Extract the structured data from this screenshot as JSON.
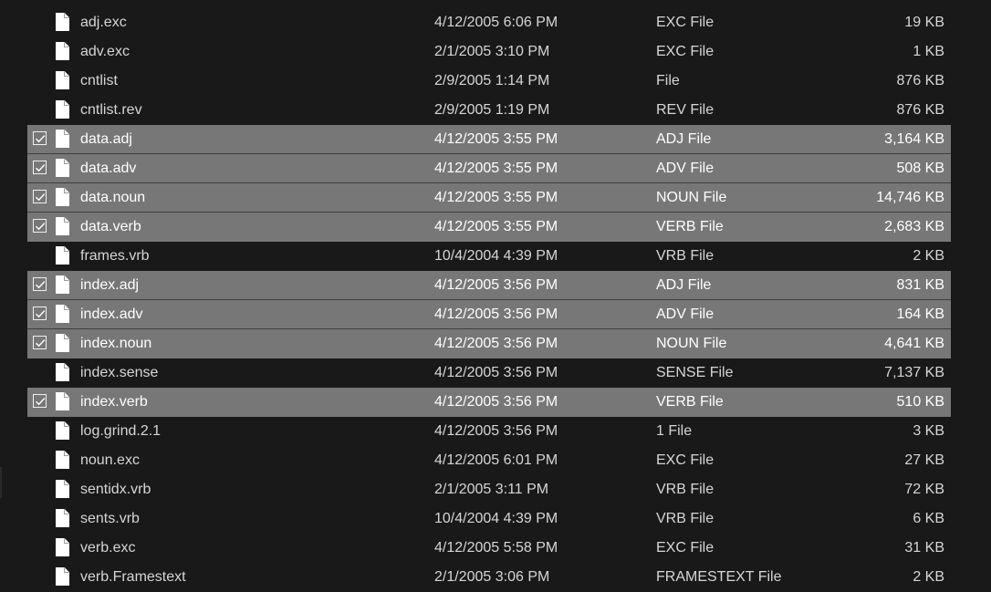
{
  "files": [
    {
      "name": "adj.exc",
      "date": "4/12/2005 6:06 PM",
      "type": "EXC File",
      "size": "19 KB",
      "selected": false
    },
    {
      "name": "adv.exc",
      "date": "2/1/2005 3:10 PM",
      "type": "EXC File",
      "size": "1 KB",
      "selected": false
    },
    {
      "name": "cntlist",
      "date": "2/9/2005 1:14 PM",
      "type": "File",
      "size": "876 KB",
      "selected": false
    },
    {
      "name": "cntlist.rev",
      "date": "2/9/2005 1:19 PM",
      "type": "REV File",
      "size": "876 KB",
      "selected": false
    },
    {
      "name": "data.adj",
      "date": "4/12/2005 3:55 PM",
      "type": "ADJ File",
      "size": "3,164 KB",
      "selected": true
    },
    {
      "name": "data.adv",
      "date": "4/12/2005 3:55 PM",
      "type": "ADV File",
      "size": "508 KB",
      "selected": true
    },
    {
      "name": "data.noun",
      "date": "4/12/2005 3:55 PM",
      "type": "NOUN File",
      "size": "14,746 KB",
      "selected": true
    },
    {
      "name": "data.verb",
      "date": "4/12/2005 3:55 PM",
      "type": "VERB File",
      "size": "2,683 KB",
      "selected": true
    },
    {
      "name": "frames.vrb",
      "date": "10/4/2004 4:39 PM",
      "type": "VRB File",
      "size": "2 KB",
      "selected": false
    },
    {
      "name": "index.adj",
      "date": "4/12/2005 3:56 PM",
      "type": "ADJ File",
      "size": "831 KB",
      "selected": true
    },
    {
      "name": "index.adv",
      "date": "4/12/2005 3:56 PM",
      "type": "ADV File",
      "size": "164 KB",
      "selected": true
    },
    {
      "name": "index.noun",
      "date": "4/12/2005 3:56 PM",
      "type": "NOUN File",
      "size": "4,641 KB",
      "selected": true
    },
    {
      "name": "index.sense",
      "date": "4/12/2005 3:56 PM",
      "type": "SENSE File",
      "size": "7,137 KB",
      "selected": false
    },
    {
      "name": "index.verb",
      "date": "4/12/2005 3:56 PM",
      "type": "VERB File",
      "size": "510 KB",
      "selected": true
    },
    {
      "name": "log.grind.2.1",
      "date": "4/12/2005 3:56 PM",
      "type": "1 File",
      "size": "3 KB",
      "selected": false
    },
    {
      "name": "noun.exc",
      "date": "4/12/2005 6:01 PM",
      "type": "EXC File",
      "size": "27 KB",
      "selected": false
    },
    {
      "name": "sentidx.vrb",
      "date": "2/1/2005 3:11 PM",
      "type": "VRB File",
      "size": "72 KB",
      "selected": false
    },
    {
      "name": "sents.vrb",
      "date": "10/4/2004 4:39 PM",
      "type": "VRB File",
      "size": "6 KB",
      "selected": false
    },
    {
      "name": "verb.exc",
      "date": "4/12/2005 5:58 PM",
      "type": "EXC File",
      "size": "31 KB",
      "selected": false
    },
    {
      "name": "verb.Framestext",
      "date": "2/1/2005 3:06 PM",
      "type": "FRAMESTEXT File",
      "size": "2 KB",
      "selected": false
    }
  ],
  "icons": {
    "file": "file-icon",
    "check": "checkmark-icon"
  },
  "colors": {
    "background": "#191919",
    "selected_row": "#777777",
    "text": "#d6d6d6",
    "selected_text": "#ffffff"
  }
}
